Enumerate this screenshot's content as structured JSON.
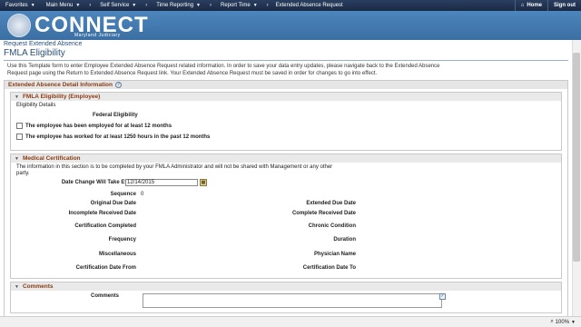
{
  "nav": {
    "items": [
      "Favorites",
      "Main Menu",
      "Self Service",
      "Time Reporting",
      "Report Time"
    ],
    "crumb_last": "Extended Absence Request",
    "home": "Home",
    "signout": "Sign out"
  },
  "logo": {
    "text": "CONNECT",
    "subtitle": "Maryland Judiciary"
  },
  "breadcrumb": "Request Extended Absence",
  "page_title": "FMLA Eligibility",
  "intro": "Use this Template form to enter Employee Extended Absence Request related information. In order to save your data entry updates, please navigate back to the Extended Absence Request page using the Return to Extended Absence Request link.  Your Extended Absence Request must be saved in order for changes to go into effect.",
  "detail_section": "Extended Absence Detail Information",
  "eligibility": {
    "header": "FMLA Eligibility (Employee)",
    "details_label": "Eligibility Details",
    "federal_label": "Federal Eligibility",
    "checkbox1": "The employee has been employed for at least 12 months",
    "checkbox2": "The employee has worked for at least 1250 hours in the past 12 months"
  },
  "medical": {
    "header": "Medical Certification",
    "note": "The information in this section is to be completed by your FMLA Administrator and will not be shared with Management or any other party.",
    "date_change_label": "Date Change Will Take Effect",
    "date_change_value": "12/14/2015",
    "sequence_label": "Sequence",
    "sequence_value": "0",
    "left_labels": [
      "Original Due Date",
      "Incomplete Received Date",
      "Certification Completed",
      "Frequency",
      "Miscellaneous",
      "Certification Date From"
    ],
    "right_labels": [
      "Extended Due Date",
      "Complete Received Date",
      "Chronic Condition",
      "Duration",
      "Physician Name",
      "Certification Date To"
    ]
  },
  "comments": {
    "header": "Comments",
    "label": "Comments"
  },
  "status": {
    "zoom": "100%"
  }
}
